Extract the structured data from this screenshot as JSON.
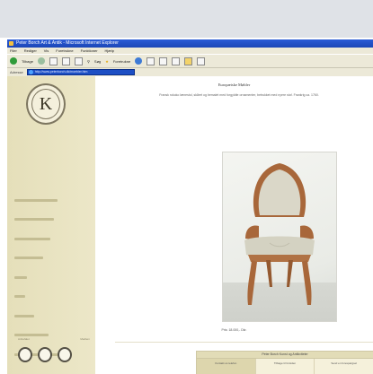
{
  "browser": {
    "title": "Peter Borch Art & Antik - Microsoft Internet Explorer",
    "menu": [
      "Filer",
      "Rediger",
      "Vis",
      "Foretrukne",
      "Funktioner",
      "Hjælp"
    ],
    "toolbar": {
      "back_label": "Tilbage",
      "search_label": "Søg",
      "favorites_label": "Foretrukne"
    },
    "address": {
      "label": "Adresse",
      "value": "http://www.peterborch.dk/moebler.htm"
    }
  },
  "site": {
    "logo_letter": "K",
    "nav_items": [
      "Europæiske møbler",
      "Europæisk kunst",
      "Porcelæn & glas",
      "Belysning",
      "Sølv",
      "Ure",
      "Bøger",
      "Kontakt",
      "Nyheder"
    ],
    "footer_labels": [
      "Anbefalet",
      "Medlem"
    ]
  },
  "main": {
    "title": "Europæiske Møbler",
    "intro": "Fransk rokoko lænestol, skåret og bemalet med forgyldte ornamenter, betrukket med nyere stof. Frankrig ca. 1760.",
    "price": "Pris: 18.000,- Dkr.",
    "table": {
      "title": "Peter Borch Kunst og Antikviteter",
      "cells": [
        "Kontakt os telefon",
        "Tilbage til forsiden",
        "Send en forespørgsel"
      ]
    }
  }
}
